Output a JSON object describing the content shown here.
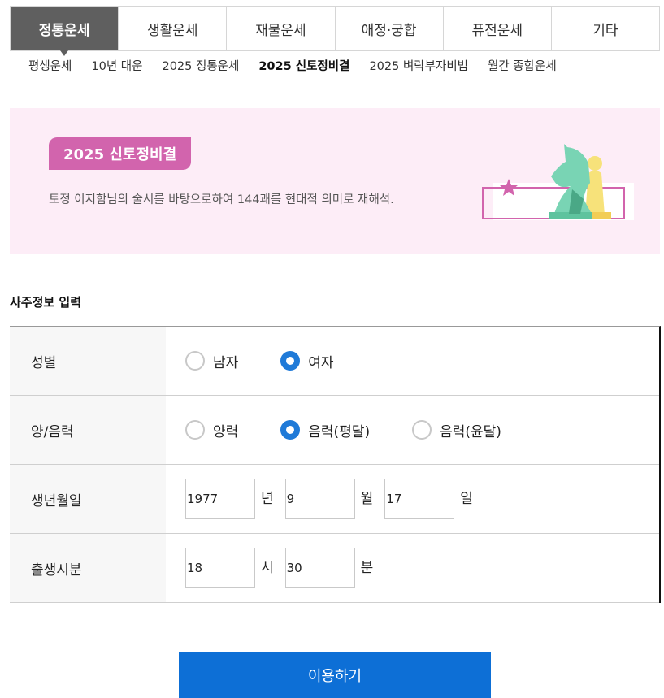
{
  "tabs": [
    {
      "label": "정통운세",
      "active": true
    },
    {
      "label": "생활운세",
      "active": false
    },
    {
      "label": "재물운세",
      "active": false
    },
    {
      "label": "애정·궁합",
      "active": false
    },
    {
      "label": "퓨전운세",
      "active": false
    },
    {
      "label": "기타",
      "active": false
    }
  ],
  "subnav": [
    {
      "label": "평생운세",
      "active": false
    },
    {
      "label": "10년 대운",
      "active": false
    },
    {
      "label": "2025 정통운세",
      "active": false
    },
    {
      "label": "2025 신토정비결",
      "active": true
    },
    {
      "label": "2025 벼락부자비법",
      "active": false
    },
    {
      "label": "월간 종합운세",
      "active": false
    }
  ],
  "banner": {
    "badge": "2025 신토정비결",
    "description": "토정 이지함님의 술서를 바탕으로하여 144괘를 현대적 의미로 재해석.",
    "colors": {
      "background": "#fdedf7",
      "badge": "#d264ad"
    }
  },
  "form": {
    "title": "사주정보 입력",
    "gender": {
      "label": "성별",
      "options": [
        {
          "label": "남자",
          "checked": false
        },
        {
          "label": "여자",
          "checked": true
        }
      ]
    },
    "calendar": {
      "label": "양/음력",
      "options": [
        {
          "label": "양력",
          "checked": false
        },
        {
          "label": "음력(평달)",
          "checked": true
        },
        {
          "label": "음력(윤달)",
          "checked": false
        }
      ]
    },
    "birthdate": {
      "label": "생년월일",
      "year": "1977",
      "year_unit": "년",
      "month": "9",
      "month_unit": "월",
      "day": "17",
      "day_unit": "일"
    },
    "birthtime": {
      "label": "출생시분",
      "hour": "18",
      "hour_unit": "시",
      "minute": "30",
      "minute_unit": "분"
    }
  },
  "submit_label": "이용하기",
  "accent_color": "#0d6fd6"
}
